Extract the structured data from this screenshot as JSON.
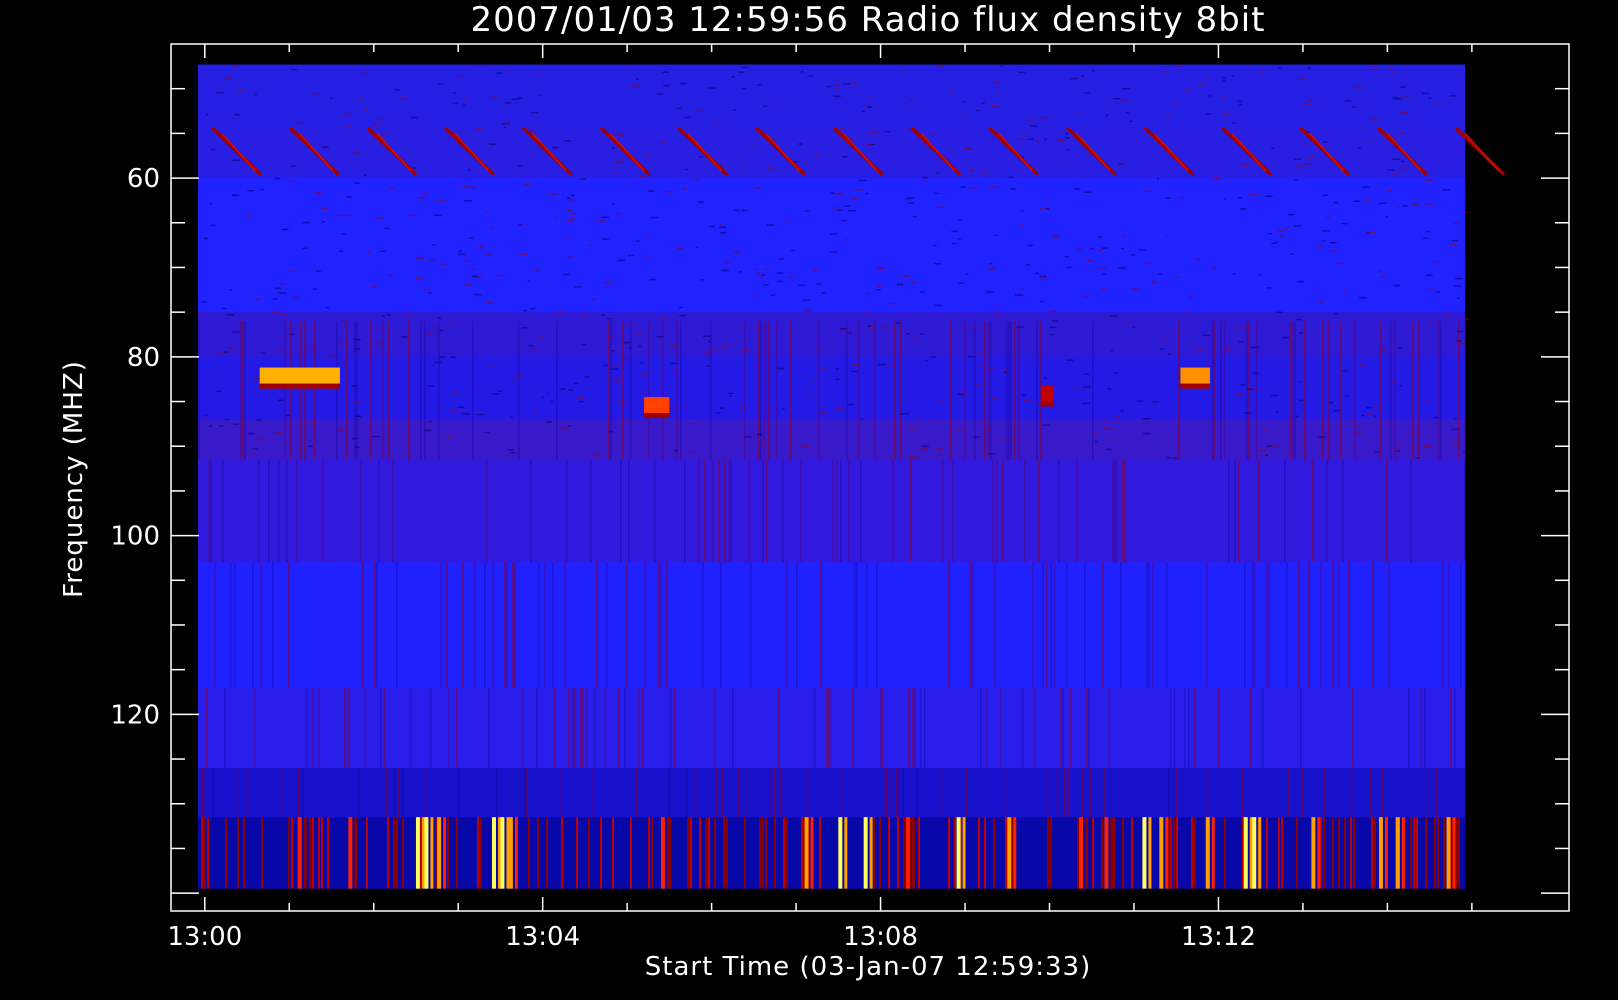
{
  "chart_data": {
    "type": "heatmap",
    "title": "2007/01/03 12:59:56 Radio flux density 8bit",
    "xlabel": "Start Time (03-Jan-07 12:59:33)",
    "ylabel": "Frequency (MHZ)",
    "x_tick_labels": [
      "13:00",
      "13:04",
      "13:08",
      "13:12"
    ],
    "x_tick_minutes": [
      0,
      4,
      8,
      12
    ],
    "x_range_minutes": [
      -0.4,
      16.15
    ],
    "data_range_minutes": [
      -0.08,
      14.92
    ],
    "y_tick_labels": [
      "60",
      "80",
      "100",
      "120"
    ],
    "y_tick_values": [
      60,
      80,
      100,
      120
    ],
    "y_range": [
      45,
      142
    ],
    "y_data_range": [
      47.3,
      139.5
    ],
    "y_inverted": true,
    "colormap": [
      "#00008b",
      "#0000ff",
      "#8b0000",
      "#ff2000",
      "#ffa000",
      "#ffff60"
    ],
    "background_color": "#2020ff",
    "features": {
      "periodic_drift_bursts": {
        "freq_start_mhz": 54.5,
        "freq_end_mhz": 59.5,
        "period_min": 0.92,
        "first_min": 0.1
      },
      "bright_patches": [
        {
          "t_start_min": 0.65,
          "t_end_min": 1.6,
          "freq_mhz": 82.2,
          "intensity": "yellow-orange"
        },
        {
          "t_start_min": 11.55,
          "t_end_min": 11.9,
          "freq_mhz": 82.2,
          "intensity": "orange"
        },
        {
          "t_start_min": 5.2,
          "t_end_min": 5.5,
          "freq_mhz": 85.5,
          "intensity": "red-orange"
        },
        {
          "t_start_min": 9.9,
          "t_end_min": 10.05,
          "freq_mhz": 84.2,
          "intensity": "red"
        }
      ],
      "hot_time_bins_low_band": [
        {
          "t_min": 1.1,
          "level": 3
        },
        {
          "t_min": 1.7,
          "level": 3
        },
        {
          "t_min": 2.5,
          "level": 5
        },
        {
          "t_min": 2.6,
          "level": 5
        },
        {
          "t_min": 2.75,
          "level": 4
        },
        {
          "t_min": 3.4,
          "level": 5
        },
        {
          "t_min": 3.5,
          "level": 5
        },
        {
          "t_min": 3.6,
          "level": 4
        },
        {
          "t_min": 5.4,
          "level": 3
        },
        {
          "t_min": 7.1,
          "level": 4
        },
        {
          "t_min": 7.5,
          "level": 5
        },
        {
          "t_min": 7.8,
          "level": 5
        },
        {
          "t_min": 8.3,
          "level": 3
        },
        {
          "t_min": 8.9,
          "level": 5
        },
        {
          "t_min": 9.5,
          "level": 4
        },
        {
          "t_min": 10.35,
          "level": 3
        },
        {
          "t_min": 10.65,
          "level": 3
        },
        {
          "t_min": 11.1,
          "level": 5
        },
        {
          "t_min": 11.3,
          "level": 4
        },
        {
          "t_min": 11.85,
          "level": 4
        },
        {
          "t_min": 12.3,
          "level": 5
        },
        {
          "t_min": 12.4,
          "level": 5
        },
        {
          "t_min": 13.1,
          "level": 4
        },
        {
          "t_min": 13.9,
          "level": 4
        },
        {
          "t_min": 14.1,
          "level": 4
        },
        {
          "t_min": 14.7,
          "level": 4
        }
      ]
    }
  }
}
